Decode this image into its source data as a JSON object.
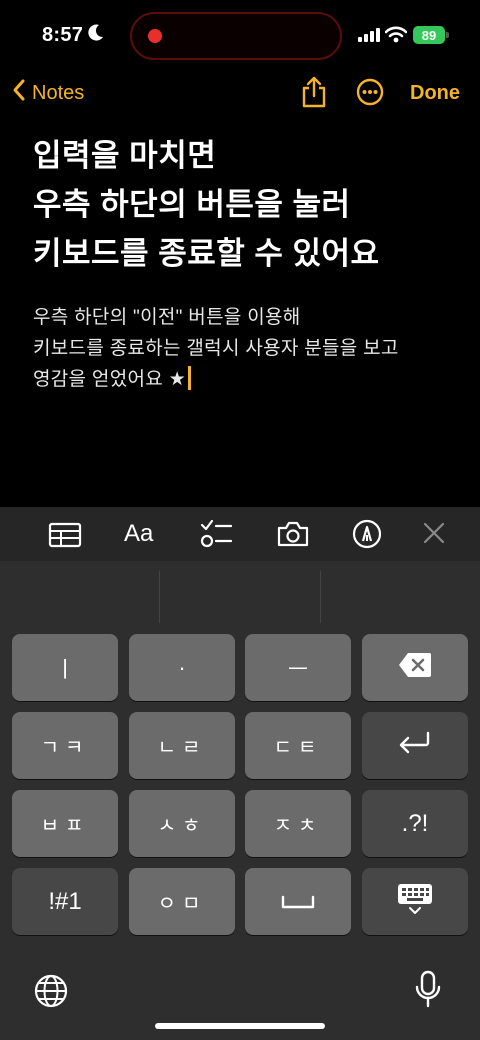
{
  "status_bar": {
    "time": "8:57",
    "battery": "89",
    "icons": [
      "moon-icon",
      "signal-icon",
      "wifi-icon",
      "battery-icon"
    ],
    "recording_color": "#e8302a"
  },
  "nav": {
    "back_label": "Notes",
    "done_label": "Done",
    "accent_color": "#f4b32a",
    "icons": [
      "chevron-left-icon",
      "share-icon",
      "more-icon"
    ]
  },
  "note": {
    "title_lines": [
      "입력을 마치면",
      "우측 하단의 버튼을 눌러",
      "키보드를 종료할 수 있어요"
    ],
    "body_lines": [
      "우측 하단의 \"이전\" 버튼을 이용해",
      "키보드를 종료하는 갤럭시 사용자 분들을 보고",
      "영감을 얻었어요 ★"
    ]
  },
  "toolbar": {
    "format_label": "Aa",
    "icons": [
      "table-icon",
      "format-icon",
      "checklist-icon",
      "camera-icon",
      "markup-icon",
      "close-icon"
    ]
  },
  "keyboard": {
    "rows": [
      [
        "ㅣ",
        "·",
        "ㅡ",
        "⌫"
      ],
      [
        "ㄱㅋ",
        "ㄴㄹ",
        "ㄷㅌ",
        "↩"
      ],
      [
        "ㅂㅍ",
        "ㅅㅎ",
        "ㅈㅊ",
        ".?!"
      ],
      [
        "!#1",
        "ㅇㅁ",
        "space",
        "⌨"
      ]
    ]
  }
}
